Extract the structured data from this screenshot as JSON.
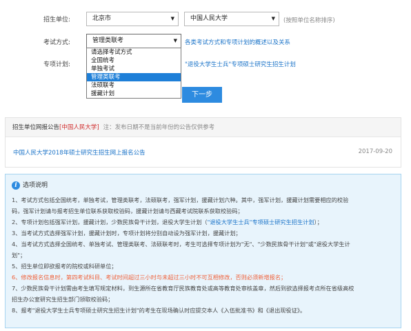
{
  "form": {
    "unit_label": "招生单位:",
    "province": "北京市",
    "school": "中国人民大学",
    "school_hint": "(按照单位名称排序)",
    "exam_label": "考试方式:",
    "exam_selected": "管理类联考",
    "exam_link": "各类考试方式和专项计划的概述以及关系",
    "plan_label": "专项计划:",
    "plan_link": "\"退役大学生士兵\"专项硕士研究生招生计划",
    "next_button": "下一步"
  },
  "dropdown": {
    "options": [
      "请选择考试方式",
      "全国统考",
      "单独考试",
      "管理类联考",
      "法硕联考",
      "援藏计划"
    ],
    "selected_index": 3
  },
  "announcement": {
    "title": "招生单位网报公告",
    "unit": "[中国人民大学]",
    "note": "注：发布日期不是当前年份的公告仅供参考",
    "item_title": "中国人民大学2018年硕士研究生招生网上报名公告",
    "item_date": "2017-09-20"
  },
  "notes": {
    "header": "选项说明",
    "lines": [
      "1、考试方式包括全国统考，单独考试，管理类联考，法硕联考，强军计划，援藏计划六种。其中，强军计划，援藏计划需要相应的校验",
      "码，强军计划请与报考招生单位联系获取校验码，援藏计划请与西藏考试院联系获取校验码；",
      "2、专项计划包括强军计划，援藏计划，少数民族骨干计划，退役大学生计划（",
      "3、当考试方式选择强军计划，援藏计划时，专项计划将分别自动设为强军计划，援藏计划；",
      "4、当考试方式选择全国统考、单独考试、管理类联考、法硕联考时，考生可选择专项计划为\"无\"、\"少数民族骨干计划\"或\"退役大学生计",
      "划\"；",
      "5、招生单位即欲报考的院校或科研单位；",
      "6、修改报名信息时，第四考试科目、考试时间超过三小时与未超过三小时不可互相修改，否则必须新增报名；",
      "7、少数民族骨干计划需由考生填写规定材料，到生源所在省教育厅民族教育处或高等教育处审核盖章，然后到欲选择报考点所在省级高校",
      "招生办公室研究生招生部门领取校验码；",
      "8、报考\"退役大学生士兵专项硕士研究生招生计划\"的考生在现场确认时应提交本人《入伍批准书》和《退出现役证》。"
    ],
    "line2_link": "\"退役大学生士兵\"专项硕士研究生招生计划",
    "line2_tail": "）；"
  },
  "colors": {
    "accent": "#2d8be0",
    "link": "#1a73c8",
    "warning": "#f0613a",
    "notes_bg": "#e8f4fc"
  },
  "icons": {
    "select_arrow": "caret-down-icon",
    "info": "info-icon"
  }
}
